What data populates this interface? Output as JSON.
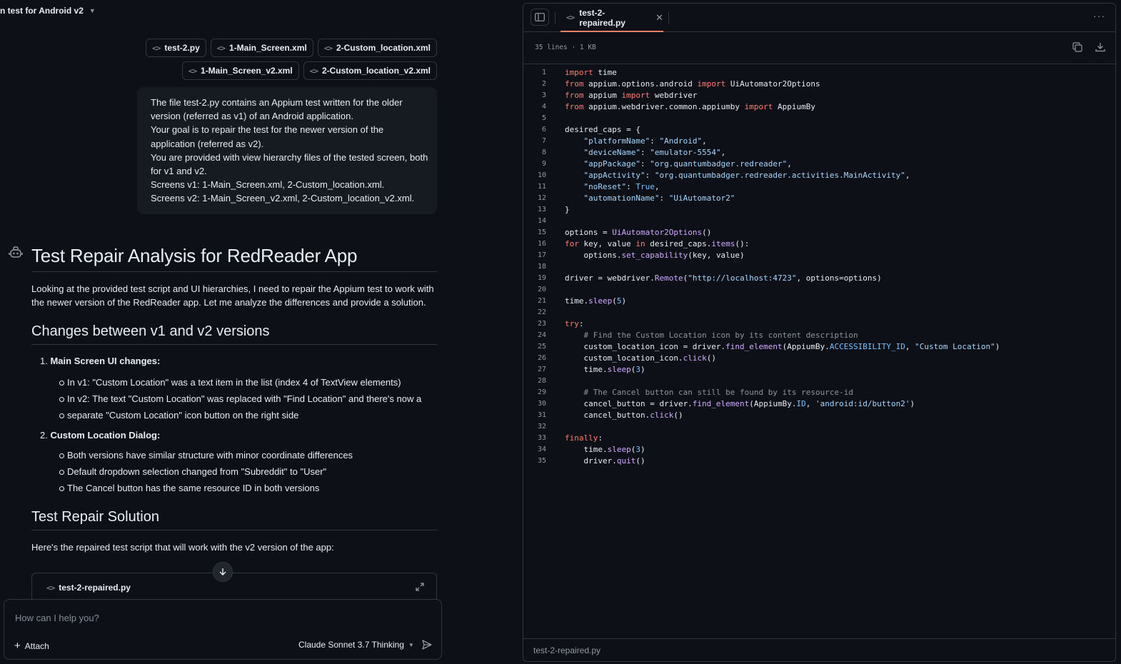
{
  "conversation": {
    "title": "n test for Android v2"
  },
  "attachments": {
    "row1": [
      "test-2.py",
      "1-Main_Screen.xml",
      "2-Custom_location.xml"
    ],
    "row2": [
      "1-Main_Screen_v2.xml",
      "2-Custom_location_v2.xml"
    ]
  },
  "user_message": {
    "lines": [
      "The file test-2.py contains an Appium test written for the older",
      "version (referred as v1) of an Android application.",
      "Your goal is to repair the test for the newer version of the",
      "application (referred as v2).",
      "You are provided with view hierarchy files of the tested screen, both",
      "for v1 and v2.",
      "Screens v1: 1-Main_Screen.xml, 2-Custom_location.xml.",
      "Screens v2: 1-Main_Screen_v2.xml, 2-Custom_location_v2.xml."
    ]
  },
  "answer": {
    "title": "Test Repair Analysis for RedReader App",
    "intro": "Looking at the provided test script and UI hierarchies, I need to repair the Appium test to work with the newer version of the RedReader app. Let me analyze the differences and provide a solution.",
    "h2_changes": "Changes between v1 and v2 versions",
    "item1_num": "1.",
    "item1_title": "Main Screen UI changes:",
    "item1_bullets": [
      "In v1: \"Custom Location\" was a text item in the list (index 4 of TextView elements)",
      "In v2: The text \"Custom Location\" was replaced with \"Find Location\" and there's now a",
      "separate \"Custom Location\" icon button on the right side"
    ],
    "item2_num": "2.",
    "item2_title": "Custom Location Dialog:",
    "item2_bullets": [
      "Both versions have similar structure with minor coordinate differences",
      "Default dropdown selection changed from \"Subreddit\" to \"User\"",
      "The Cancel button has the same resource ID in both versions"
    ],
    "h2_solution": "Test Repair Solution",
    "solution_intro": "Here's the repaired test script that will work with the v2 version of the app:",
    "artifact_name": "test-2-repaired.py"
  },
  "composer": {
    "placeholder": "How can I help you?",
    "attach_label": "Attach",
    "model_label": "Claude Sonnet 3.7 Thinking"
  },
  "viewer": {
    "tab_label": "test-2-repaired.py",
    "meta": "35 lines · 1 KB",
    "footer": "test-2-repaired.py",
    "code_lines": [
      "import time",
      "from appium.options.android import UiAutomator2Options",
      "from appium import webdriver",
      "from appium.webdriver.common.appiumby import AppiumBy",
      "",
      "desired_caps = {",
      "    \"platformName\": \"Android\",",
      "    \"deviceName\": \"emulator-5554\",",
      "    \"appPackage\": \"org.quantumbadger.redreader\",",
      "    \"appActivity\": \"org.quantumbadger.redreader.activities.MainActivity\",",
      "    \"noReset\": True,",
      "    \"automationName\": \"UiAutomator2\"",
      "}",
      "",
      "options = UiAutomator2Options()",
      "for key, value in desired_caps.items():",
      "    options.set_capability(key, value)",
      "",
      "driver = webdriver.Remote(\"http://localhost:4723\", options=options)",
      "",
      "time.sleep(5)",
      "",
      "try:",
      "    # Find the Custom Location icon by its content description",
      "    custom_location_icon = driver.find_element(AppiumBy.ACCESSIBILITY_ID, \"Custom Location\")",
      "    custom_location_icon.click()",
      "    time.sleep(3)",
      "",
      "    # The Cancel button can still be found by its resource-id",
      "    cancel_button = driver.find_element(AppiumBy.ID, 'android:id/button2')",
      "    cancel_button.click()",
      "",
      "finally:",
      "    time.sleep(3)",
      "    driver.quit()"
    ]
  },
  "colors": {
    "background": "#0d1117",
    "border": "#30363d",
    "tab_accent": "#f78166",
    "keyword": "#ff7b72",
    "string": "#a5d6ff",
    "function": "#d2a8ff",
    "comment": "#8b949e"
  }
}
